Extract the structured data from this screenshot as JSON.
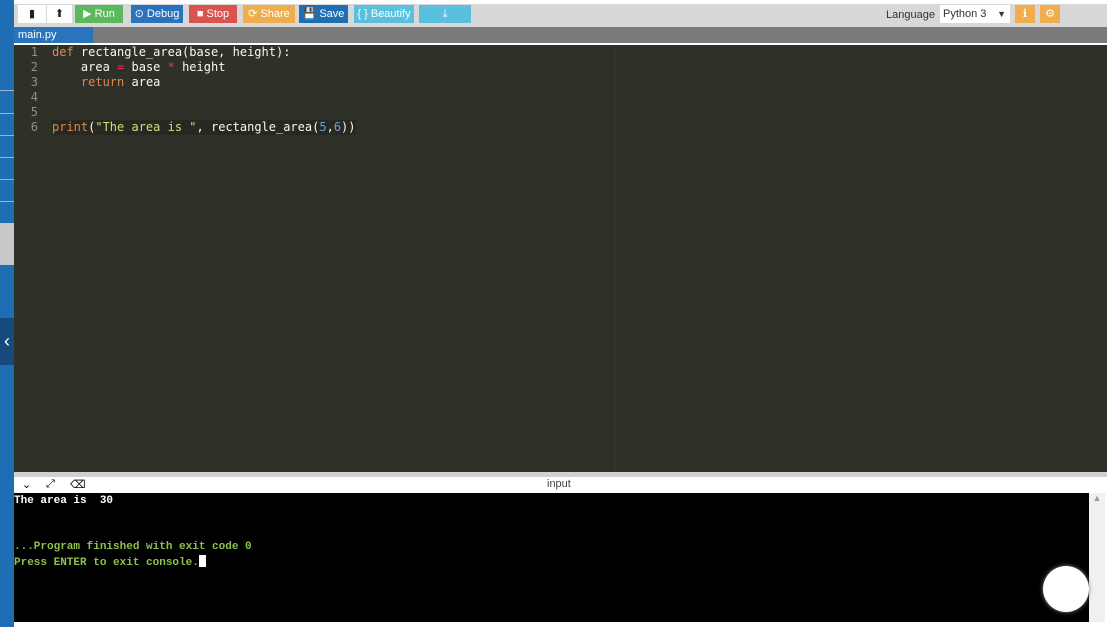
{
  "toolbar": {
    "run": "▶ Run",
    "debug": "⊙ Debug",
    "stop": "■ Stop",
    "share": "⟳ Share",
    "save": "💾 Save",
    "beautify": "{ } Beautify",
    "download": "⤓",
    "language_label": "Language",
    "language_value": "Python 3"
  },
  "file_tab": "main.py",
  "code": {
    "line_numbers": [
      "1",
      "2",
      "3",
      "4",
      "5",
      "6"
    ]
  },
  "console": {
    "header": "input",
    "output": [
      "The area is  30",
      "",
      "",
      "...Program finished with exit code 0",
      "Press ENTER to exit console."
    ]
  },
  "colors": {
    "run": "#5cb85c",
    "debug": "#2a74bd",
    "stop": "#d9534f",
    "share": "#f0ad4e",
    "save": "#1f6db3",
    "beautify": "#5bc0de"
  }
}
